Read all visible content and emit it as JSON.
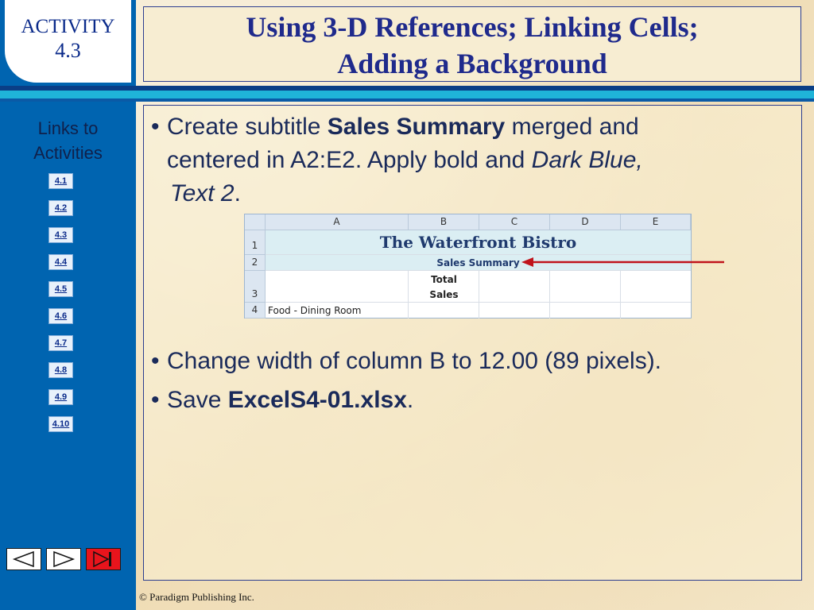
{
  "slide": {
    "activity_label": "ACTIVITY",
    "activity_number": "4.3",
    "title_line1": "Using 3-D References; Linking Cells;",
    "title_line2": "Adding a Background"
  },
  "sidebar": {
    "links_title_line1": "Links to",
    "links_title_line2": "Activities",
    "links": [
      "4.1",
      "4.2",
      "4.3",
      "4.4",
      "4.5",
      "4.6",
      "4.7",
      "4.8",
      "4.9",
      "4.10"
    ],
    "nav": [
      "previous-slide",
      "next-slide",
      "end-show"
    ]
  },
  "bullets": {
    "b1": {
      "t1": "Create subtitle ",
      "b": "Sales Summary",
      "t2": " merged and",
      "t3": "centered in A2:E2. Apply bold and ",
      "i1": "Dark Blue,",
      "i2": "Text 2",
      "t4": "."
    },
    "b2": "Change width of column B to 12.00 (89 pixels).",
    "b3": {
      "t1": "Save ",
      "b": "ExcelS4-01.xlsx",
      "t2": "."
    }
  },
  "spreadsheet": {
    "columns": [
      "A",
      "B",
      "C",
      "D",
      "E"
    ],
    "rows": [
      "1",
      "2",
      "3",
      "4"
    ],
    "title": "The Waterfront Bistro",
    "subtitle": "Sales Summary",
    "b3_line1": "Total",
    "b3_line2": "Sales",
    "a4": "Food - Dining Room"
  },
  "colors": {
    "title_text": "#1f2a8c",
    "sidebar": "#0064b0",
    "arrow": "#c0141c",
    "sheet_title": "#1f3a6e"
  },
  "footer": "© Paradigm Publishing Inc."
}
